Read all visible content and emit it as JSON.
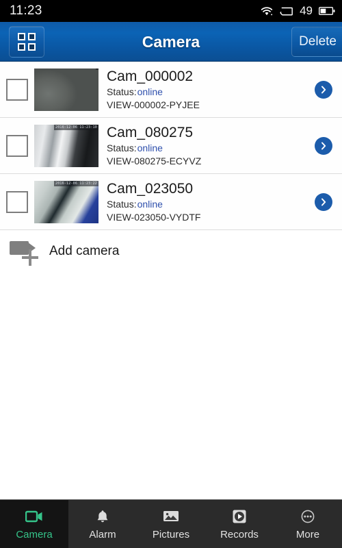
{
  "status_bar": {
    "time": "11:23",
    "battery_percent": "49",
    "icons": [
      "wifi-icon",
      "sim-icon",
      "battery-icon"
    ]
  },
  "header": {
    "grid_button_icon": "grid-view-icon",
    "title": "Camera",
    "delete_label": "Delete"
  },
  "list": {
    "status_label": "Status:",
    "cameras": [
      {
        "name": "Cam_000002",
        "status": "online",
        "uid": "VIEW-000002-PYJEE",
        "thumb_timestamp": ""
      },
      {
        "name": "Cam_080275",
        "status": "online",
        "uid": "VIEW-080275-ECYVZ",
        "thumb_timestamp": "2016-12-06 11:23:10"
      },
      {
        "name": "Cam_023050",
        "status": "online",
        "uid": "VIEW-023050-VYDTF",
        "thumb_timestamp": "2016-12-06 11:23:22"
      }
    ],
    "add_camera_label": "Add camera",
    "add_camera_icon": "video-camera-plus-icon"
  },
  "bottom_nav": {
    "items": [
      {
        "label": "Camera",
        "icon": "video-camera-icon",
        "active": true
      },
      {
        "label": "Alarm",
        "icon": "bell-icon",
        "active": false
      },
      {
        "label": "Pictures",
        "icon": "image-icon",
        "active": false
      },
      {
        "label": "Records",
        "icon": "play-icon",
        "active": false
      },
      {
        "label": "More",
        "icon": "more-dots-icon",
        "active": false
      }
    ]
  },
  "colors": {
    "header_blue": "#0b5ba8",
    "status_online_blue": "#2f50ad",
    "accent_green": "#35c48a",
    "nav_background": "#2b2b2b"
  }
}
